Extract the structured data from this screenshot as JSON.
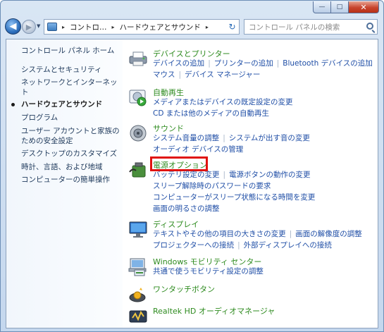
{
  "window": {
    "caption": {
      "minimize": "—",
      "maximize": "□",
      "close": "✕"
    }
  },
  "nav": {
    "back_glyph": "◀",
    "forward_glyph": "▶",
    "dropdown_glyph": "▼",
    "address": {
      "segments": [
        "コントロ…",
        "ハードウェアとサウンド"
      ],
      "separator": "▸",
      "dropdown_glyph": "▾"
    },
    "refresh_glyph": "↻",
    "search": {
      "placeholder": "コントロール パネルの検索"
    }
  },
  "sidebar": {
    "items": [
      {
        "label": "コントロール パネル ホーム"
      },
      {
        "label": "システムとセキュリティ"
      },
      {
        "label": "ネットワークとインターネット"
      },
      {
        "label": "ハードウェアとサウンド",
        "active": true
      },
      {
        "label": "プログラム"
      },
      {
        "label": "ユーザー アカウントと家族のための安全設定"
      },
      {
        "label": "デスクトップのカスタマイズ"
      },
      {
        "label": "時計、言語、および地域"
      },
      {
        "label": "コンピューターの簡単操作"
      }
    ]
  },
  "categories": [
    {
      "title": "デバイスとプリンター",
      "icon": "printer-icon",
      "lines": [
        [
          "デバイスの追加",
          "プリンターの追加",
          "Bluetooth デバイスの追加"
        ],
        [
          "マウス",
          "デバイス マネージャー"
        ]
      ]
    },
    {
      "title": "自動再生",
      "icon": "autoplay-icon",
      "lines": [
        [
          "メディアまたはデバイスの既定設定の変更"
        ],
        [
          "CD または他のメディアの自動再生"
        ]
      ]
    },
    {
      "title": "サウンド",
      "icon": "speaker-icon",
      "lines": [
        [
          "システム音量の調整",
          "システムが出す音の変更"
        ],
        [
          "オーディオ デバイスの管理"
        ]
      ]
    },
    {
      "title": "電源オプション",
      "icon": "power-options-icon",
      "highlighted": true,
      "lines": [
        [
          "バッテリ設定の変更",
          "電源ボタンの動作の変更"
        ],
        [
          "スリープ解除時のパスワードの要求"
        ],
        [
          "コンピューターがスリープ状態になる時間を変更"
        ],
        [
          "画面の明るさの調整"
        ]
      ]
    },
    {
      "title": "ディスプレイ",
      "icon": "display-icon",
      "lines": [
        [
          "テキストやその他の項目の大きさの変更",
          "画面の解像度の調整"
        ],
        [
          "プロジェクターへの接続",
          "外部ディスプレイへの接続"
        ]
      ]
    },
    {
      "title": "Windows モビリティ センター",
      "icon": "mobility-center-icon",
      "lines": [
        [
          "共通で使うモビリティ設定の調整"
        ]
      ]
    },
    {
      "title": "ワンタッチボタン",
      "icon": "onetouch-icon",
      "lines": []
    },
    {
      "title": "Realtek HD オーディオマネージャ",
      "icon": "realtek-audio-icon",
      "lines": []
    }
  ],
  "colors": {
    "link": "#1f4ea6",
    "category_title": "#2e8b1f",
    "highlight": "#e0120f"
  }
}
